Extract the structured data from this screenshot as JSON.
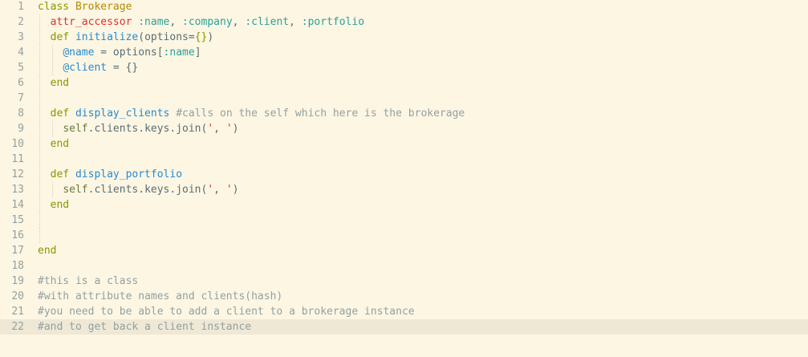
{
  "editor": {
    "active_line": 22,
    "colors": {
      "background": "#fdf6e3",
      "active_line": "#eee8d5",
      "keyword": "#859900",
      "class_name": "#b58900",
      "symbol": "#2aa198",
      "function": "#268bd2",
      "comment": "#93a1a1"
    },
    "lines": [
      {
        "n": "1",
        "indent": 0,
        "tokens": [
          [
            "class",
            "kw"
          ],
          [
            " ",
            "txt"
          ],
          [
            "Brokerage",
            "cls"
          ]
        ]
      },
      {
        "n": "2",
        "indent": 1,
        "tokens": [
          [
            "attr_accessor",
            "call"
          ],
          [
            " ",
            "txt"
          ],
          [
            ":name",
            "sym"
          ],
          [
            ", ",
            "txt"
          ],
          [
            ":company",
            "sym"
          ],
          [
            ", ",
            "txt"
          ],
          [
            ":client",
            "sym"
          ],
          [
            ", ",
            "txt"
          ],
          [
            ":portfolio",
            "sym"
          ]
        ]
      },
      {
        "n": "3",
        "indent": 1,
        "tokens": [
          [
            "def",
            "kw"
          ],
          [
            " ",
            "txt"
          ],
          [
            "initialize",
            "fn"
          ],
          [
            "(options=",
            "txt"
          ],
          [
            "{}",
            "kw"
          ],
          [
            ")",
            "txt"
          ]
        ]
      },
      {
        "n": "4",
        "indent": 2,
        "tokens": [
          [
            "@name",
            "ivar"
          ],
          [
            " = options[",
            "txt"
          ],
          [
            ":name",
            "sym"
          ],
          [
            "]",
            "txt"
          ]
        ]
      },
      {
        "n": "5",
        "indent": 2,
        "tokens": [
          [
            "@client",
            "ivar"
          ],
          [
            " = {}",
            "txt"
          ]
        ]
      },
      {
        "n": "6",
        "indent": 1,
        "tokens": [
          [
            "end",
            "kw"
          ]
        ]
      },
      {
        "n": "7",
        "indent": 1,
        "tokens": []
      },
      {
        "n": "8",
        "indent": 1,
        "tokens": [
          [
            "def",
            "kw"
          ],
          [
            " ",
            "txt"
          ],
          [
            "display_clients",
            "fn"
          ],
          [
            " ",
            "txt"
          ],
          [
            "#calls on the self which here is the brokerage",
            "cmt"
          ]
        ]
      },
      {
        "n": "9",
        "indent": 2,
        "tokens": [
          [
            "self",
            "self"
          ],
          [
            ".clients.keys.join(",
            "txt"
          ],
          [
            "'",
            "str"
          ],
          [
            ", ",
            "txt"
          ],
          [
            "'",
            "str"
          ],
          [
            ")",
            "txt"
          ]
        ]
      },
      {
        "n": "10",
        "indent": 1,
        "tokens": [
          [
            "end",
            "kw"
          ]
        ]
      },
      {
        "n": "11",
        "indent": 1,
        "tokens": []
      },
      {
        "n": "12",
        "indent": 1,
        "tokens": [
          [
            "def",
            "kw"
          ],
          [
            " ",
            "txt"
          ],
          [
            "display_portfolio",
            "fn"
          ]
        ]
      },
      {
        "n": "13",
        "indent": 2,
        "tokens": [
          [
            "self",
            "self"
          ],
          [
            ".clients.keys.join(",
            "txt"
          ],
          [
            "'",
            "str"
          ],
          [
            ", ",
            "txt"
          ],
          [
            "'",
            "str"
          ],
          [
            ")",
            "txt"
          ]
        ]
      },
      {
        "n": "14",
        "indent": 1,
        "tokens": [
          [
            "end",
            "kw"
          ]
        ]
      },
      {
        "n": "15",
        "indent": 1,
        "tokens": []
      },
      {
        "n": "16",
        "indent": 1,
        "tokens": []
      },
      {
        "n": "17",
        "indent": 0,
        "tokens": [
          [
            "end",
            "kw"
          ]
        ]
      },
      {
        "n": "18",
        "indent": 0,
        "tokens": []
      },
      {
        "n": "19",
        "indent": 0,
        "tokens": [
          [
            "#this is a class",
            "cmt"
          ]
        ]
      },
      {
        "n": "20",
        "indent": 0,
        "tokens": [
          [
            "#with attribute names and clients(hash)",
            "cmt"
          ]
        ]
      },
      {
        "n": "21",
        "indent": 0,
        "tokens": [
          [
            "#you need to be able to add a client to a brokerage instance",
            "cmt"
          ]
        ]
      },
      {
        "n": "22",
        "indent": 0,
        "tokens": [
          [
            "#and to get back a client instance",
            "cmt"
          ]
        ]
      }
    ]
  }
}
